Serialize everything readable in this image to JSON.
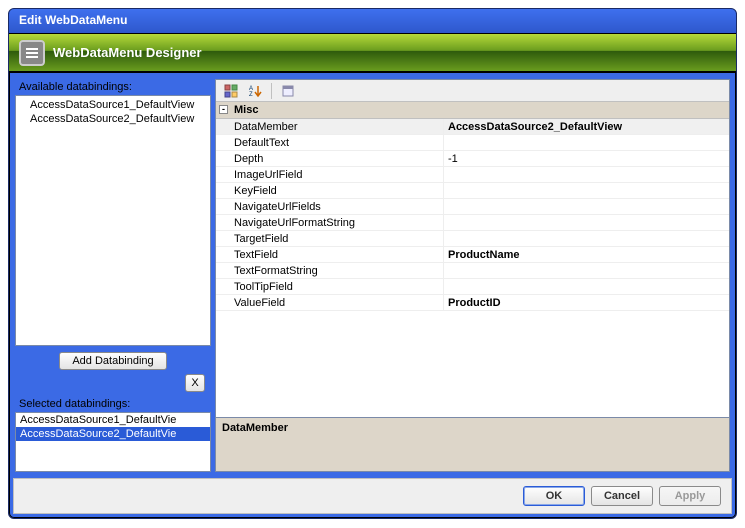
{
  "window": {
    "title": "Edit WebDataMenu"
  },
  "banner": {
    "title": "WebDataMenu Designer"
  },
  "left": {
    "availableLabel": "Available databindings:",
    "availableItems": [
      "AccessDataSource1_DefaultView",
      "AccessDataSource2_DefaultView"
    ],
    "addBtn": "Add Databinding",
    "closeBtn": "X",
    "selectedLabel": "Selected databindings:",
    "selectedItems": [
      {
        "text": "AccessDataSource1_DefaultVie",
        "selected": false
      },
      {
        "text": "AccessDataSource2_DefaultVie",
        "selected": true
      }
    ]
  },
  "grid": {
    "category": "Misc",
    "rows": [
      {
        "name": "DataMember",
        "value": "AccessDataSource2_DefaultView",
        "bold": true,
        "selected": true
      },
      {
        "name": "DefaultText",
        "value": ""
      },
      {
        "name": "Depth",
        "value": "-1"
      },
      {
        "name": "ImageUrlField",
        "value": ""
      },
      {
        "name": "KeyField",
        "value": ""
      },
      {
        "name": "NavigateUrlFields",
        "value": ""
      },
      {
        "name": "NavigateUrlFormatString",
        "value": ""
      },
      {
        "name": "TargetField",
        "value": ""
      },
      {
        "name": "TextField",
        "value": "ProductName",
        "bold": true
      },
      {
        "name": "TextFormatString",
        "value": ""
      },
      {
        "name": "ToolTipField",
        "value": ""
      },
      {
        "name": "ValueField",
        "value": "ProductID",
        "bold": true
      }
    ],
    "descTitle": "DataMember"
  },
  "footer": {
    "ok": "OK",
    "cancel": "Cancel",
    "apply": "Apply"
  }
}
